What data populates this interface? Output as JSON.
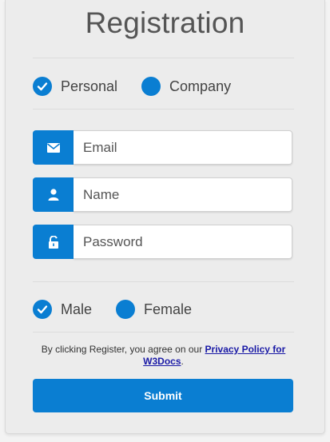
{
  "form": {
    "title": "Registration",
    "account_type": [
      {
        "label": "Personal",
        "checked": true
      },
      {
        "label": "Company",
        "checked": false
      }
    ],
    "fields": {
      "email": {
        "placeholder": "Email",
        "icon": "envelope-icon"
      },
      "name": {
        "placeholder": "Name",
        "icon": "user-icon"
      },
      "password": {
        "placeholder": "Password",
        "icon": "lock-icon"
      }
    },
    "gender": [
      {
        "label": "Male",
        "checked": true
      },
      {
        "label": "Female",
        "checked": false
      }
    ],
    "terms": {
      "text": "By clicking Register, you agree on our ",
      "link": "Privacy Policy for W3Docs",
      "suffix": "."
    },
    "submit_label": "Submit"
  },
  "colors": {
    "accent": "#0a7ed2",
    "link": "#1a1aa6"
  }
}
